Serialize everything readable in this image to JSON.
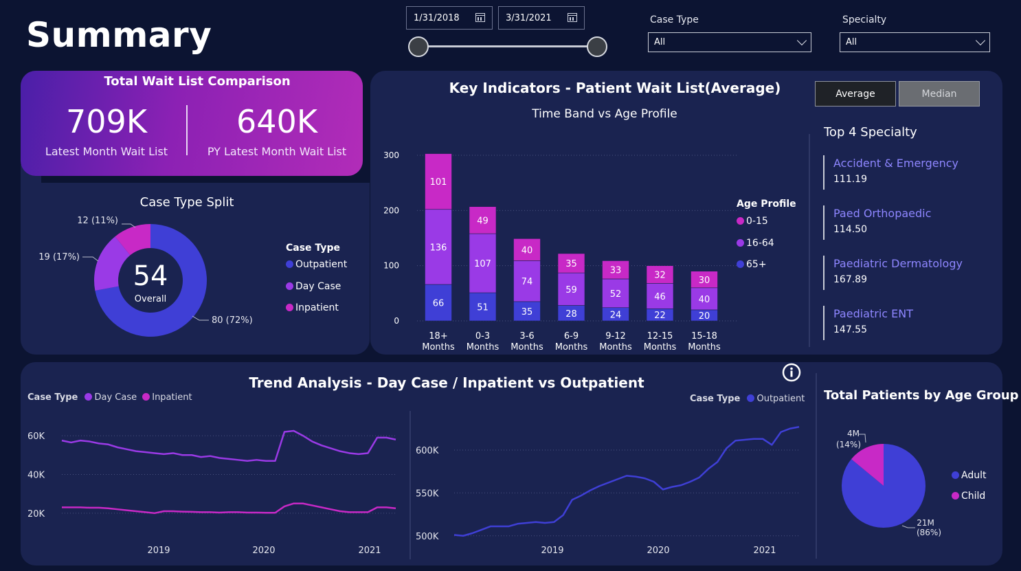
{
  "header": {
    "title": "Summary",
    "date_start": "1/31/2018",
    "date_end": "3/31/2021",
    "case_type_label": "Case Type",
    "case_type_value": "All",
    "specialty_label": "Specialty",
    "specialty_value": "All"
  },
  "wait_list": {
    "title": "Total Wait List Comparison",
    "latest_value": "709K",
    "latest_label": "Latest Month Wait List",
    "py_value": "640K",
    "py_label": "PY Latest Month Wait List"
  },
  "case_split": {
    "title": "Case Type Split",
    "center_value": "54",
    "center_label": "Overall",
    "legend_title": "Case Type",
    "slices": [
      {
        "name": "Outpatient",
        "value": 80,
        "label": "80 (72%)",
        "color": "#3f3fd6"
      },
      {
        "name": "Day Case",
        "value": 19,
        "label": "19 (17%)",
        "color": "#9a3ae6"
      },
      {
        "name": "Inpatient",
        "value": 12,
        "label": "12 (11%)",
        "color": "#c829c6"
      }
    ]
  },
  "key_indicators": {
    "title": "Key Indicators - Patient Wait List(Average)",
    "subtitle": "Time Band vs Age Profile",
    "average_label": "Average",
    "median_label": "Median",
    "legend_title": "Age Profile",
    "legend": [
      {
        "name": "0-15",
        "color": "#c829c6"
      },
      {
        "name": "16-64",
        "color": "#9a3ae6"
      },
      {
        "name": "65+",
        "color": "#3f3fd6"
      }
    ],
    "top_title": "Top 4 Specialty",
    "specialties": [
      {
        "name": "Accident & Emergency",
        "value": "111.19"
      },
      {
        "name": "Paed Orthopaedic",
        "value": "114.50"
      },
      {
        "name": "Paediatric Dermatology",
        "value": "167.89"
      },
      {
        "name": "Paediatric ENT",
        "value": "147.55"
      }
    ]
  },
  "trend": {
    "title": "Trend Analysis - Day Case / Inpatient vs Outpatient",
    "legend_left_title": "Case Type",
    "legend_left": [
      {
        "name": "Day Case",
        "color": "#9a3ae6"
      },
      {
        "name": "Inpatient",
        "color": "#c829c6"
      }
    ],
    "legend_right_title": "Case Type",
    "legend_right": [
      {
        "name": "Outpatient",
        "color": "#3f3fd6"
      }
    ]
  },
  "age_group": {
    "title": "Total Patients by Age Group",
    "legend": [
      {
        "name": "Adult",
        "color": "#3f3fd6"
      },
      {
        "name": "Child",
        "color": "#c829c6"
      }
    ],
    "child_label_1": "4M",
    "child_label_2": "(14%)",
    "adult_label_1": "21M",
    "adult_label_2": "(86%)"
  },
  "chart_data": [
    {
      "type": "bar",
      "stacked": true,
      "title": "Key Indicators - Patient Wait List(Average)",
      "subtitle": "Time Band vs Age Profile",
      "categories": [
        "18+ Months",
        "0-3 Months",
        "3-6 Months",
        "6-9 Months",
        "9-12 Months",
        "12-15 Months",
        "15-18 Months"
      ],
      "series": [
        {
          "name": "65+",
          "color": "#3f3fd6",
          "values": [
            66,
            51,
            35,
            28,
            24,
            22,
            20
          ]
        },
        {
          "name": "16-64",
          "color": "#9a3ae6",
          "values": [
            136,
            107,
            74,
            59,
            52,
            46,
            40
          ]
        },
        {
          "name": "0-15",
          "color": "#c829c6",
          "values": [
            101,
            49,
            40,
            35,
            33,
            32,
            30
          ]
        }
      ],
      "ylim": [
        0,
        300
      ],
      "yticks": [
        0,
        100,
        200,
        300
      ],
      "legend_position": "right",
      "grid": true
    },
    {
      "type": "line",
      "x_start": "2018-02",
      "x_end": "2021-03",
      "xticks": [
        "2019",
        "2020",
        "2021"
      ],
      "yticks": [
        "20K",
        "40K",
        "60K"
      ],
      "ylim": [
        10000,
        65000
      ],
      "series": [
        {
          "name": "Day Case",
          "color": "#9a3ae6",
          "values": [
            57500,
            56500,
            57500,
            57000,
            56000,
            55500,
            54000,
            53000,
            52000,
            51500,
            51000,
            50500,
            51000,
            50000,
            50000,
            49000,
            49500,
            48500,
            48000,
            47500,
            47000,
            47500,
            47000,
            47000,
            62000,
            62500,
            60000,
            57000,
            55000,
            53500,
            52000,
            51000,
            50500,
            51000,
            59000,
            59000,
            58000
          ]
        },
        {
          "name": "Inpatient",
          "color": "#c829c6",
          "values": [
            23000,
            23000,
            23000,
            22800,
            22800,
            22500,
            22000,
            21500,
            21000,
            20500,
            20000,
            21000,
            21000,
            20800,
            20700,
            20500,
            20500,
            20300,
            20500,
            20500,
            20300,
            20300,
            20200,
            20200,
            23500,
            25000,
            25000,
            24000,
            23000,
            22000,
            21000,
            20500,
            20500,
            20500,
            23000,
            23000,
            22500
          ]
        }
      ],
      "legend_position": "top-left",
      "grid": true
    },
    {
      "type": "line",
      "x_start": "2018-02",
      "x_end": "2021-03",
      "xticks": [
        "2019",
        "2020",
        "2021"
      ],
      "yticks": [
        "500K",
        "550K",
        "600K"
      ],
      "ylim": [
        495000,
        628000
      ],
      "series": [
        {
          "name": "Outpatient",
          "color": "#3f3fd6",
          "values": [
            501000,
            500000,
            503000,
            507000,
            511000,
            511000,
            511000,
            514000,
            515000,
            516000,
            515000,
            516000,
            524000,
            542000,
            547000,
            553000,
            558000,
            562000,
            566000,
            570000,
            569000,
            567000,
            563000,
            554000,
            557000,
            559000,
            563000,
            568000,
            578000,
            586000,
            602000,
            611000,
            612000,
            613000,
            613000,
            606000,
            621000,
            625000,
            627000
          ]
        }
      ],
      "legend_position": "top-right",
      "grid": true
    },
    {
      "type": "pie",
      "title": "Total Patients by Age Group",
      "labels": [
        "Adult",
        "Child"
      ],
      "values": [
        21,
        4
      ],
      "percents": [
        86,
        14
      ],
      "units": "M",
      "legend_position": "right"
    }
  ]
}
